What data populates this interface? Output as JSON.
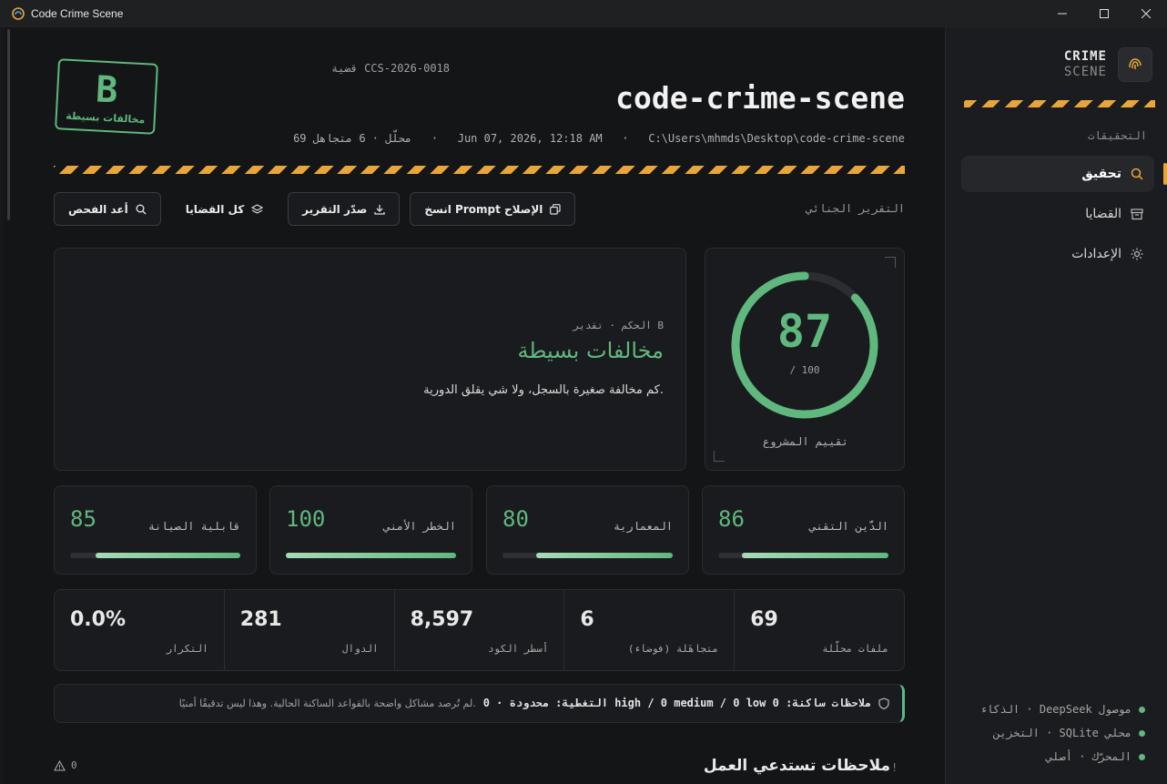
{
  "window": {
    "title": "Code Crime Scene"
  },
  "brand": {
    "line1": "CRIME",
    "line2": "SCENE"
  },
  "sidebar": {
    "section": "التحقيقات",
    "items": [
      {
        "label": "تحقيق",
        "icon": "search-icon",
        "active": true
      },
      {
        "label": "القضايا",
        "icon": "archive-icon",
        "active": false
      },
      {
        "label": "الإعدادات",
        "icon": "gear-icon",
        "active": false
      }
    ],
    "status": [
      "الذكاء · DeepSeek موصول",
      "التخزين · SQLite محلي",
      "المحرّك · أصلي"
    ]
  },
  "header": {
    "stamp_grade": "B",
    "stamp_label": "مخالفات بسيطة",
    "case_id": "قضية CCS-2026-0018",
    "title": "code-crime-scene",
    "meta": "69 محلّل · 6 متجاهل   ·   Jun 07, 2026, 12:18 AM   ·   C:\\Users\\mhmds\\Desktop\\code-crime-scene"
  },
  "toolbar": {
    "copy_prompt": "انسخ Prompt الإصلاح",
    "export": "صدّر التقرير",
    "all_cases": "كل القضايا",
    "rescan": "أعد الفحص",
    "report_label": "التقرير الجنائي"
  },
  "verdict": {
    "kicker": "الحكم · تقدير B",
    "title": "مخالفات بسيطة",
    "description": "كم مخالفة صغيرة بالسجل، ولا شي يقلق الدورية."
  },
  "score": {
    "value": "87",
    "max_label": "/ 100",
    "max": 100,
    "caption": "تقييم المشروع"
  },
  "metrics": [
    {
      "label": "الدَّين التقني",
      "value": "86"
    },
    {
      "label": "المعمارية",
      "value": "80"
    },
    {
      "label": "الخطر الأمني",
      "value": "100"
    },
    {
      "label": "قابلية الصيانة",
      "value": "85"
    }
  ],
  "stats": [
    {
      "label": "ملفات محلّلة",
      "value": "69"
    },
    {
      "label": "متجاهَلة (فوضاء)",
      "value": "6"
    },
    {
      "label": "أسطر الكود",
      "value": "8,597"
    },
    {
      "label": "الدوال",
      "value": "281"
    },
    {
      "label": "التكرار",
      "value": "0.0%"
    }
  ],
  "coverage": {
    "strong": "التغطية: محدودة · 0 high / 0 medium / 0 low ملاحظات ساكنة: 0",
    "soft": "لم تُرصد مشاكل واضحة بالقواعد الساكنة الحالية. وهذا ليس تدقيقًا أمنيًا."
  },
  "notes": {
    "title": "ملاحظات تستدعي العمل",
    "count": "0"
  },
  "colors": {
    "accent_green": "#5fb87d",
    "tape_yellow": "#e8a63a",
    "bg": "#141517"
  }
}
